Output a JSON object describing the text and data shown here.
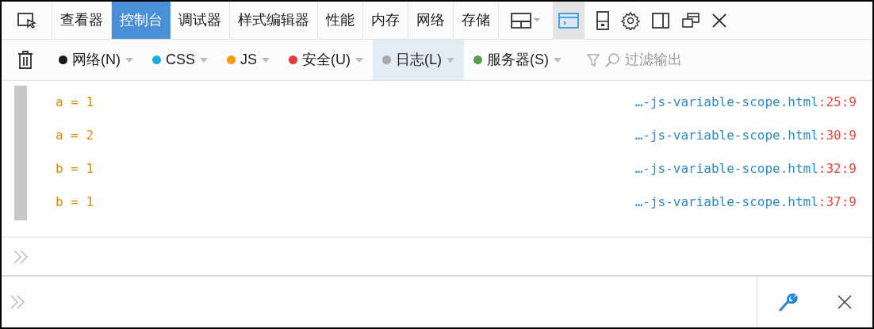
{
  "tabs": [
    {
      "label": "查看器",
      "selected": false
    },
    {
      "label": "控制台",
      "selected": true
    },
    {
      "label": "调试器",
      "selected": false
    },
    {
      "label": "样式编辑器",
      "selected": false
    },
    {
      "label": "性能",
      "selected": false
    },
    {
      "label": "内存",
      "selected": false
    },
    {
      "label": "网络",
      "selected": false
    },
    {
      "label": "存储",
      "selected": false
    }
  ],
  "filters": [
    {
      "label": "网络(N)",
      "color": "#1a1a1a",
      "selected": false
    },
    {
      "label": "CSS",
      "color": "#1fa9e1",
      "selected": false
    },
    {
      "label": "JS",
      "color": "#f39c12",
      "selected": false
    },
    {
      "label": "安全(U)",
      "color": "#e8373e",
      "selected": false
    },
    {
      "label": "日志(L)",
      "color": "#a8a8a8",
      "selected": true
    },
    {
      "label": "服务器(S)",
      "color": "#5a9e4b",
      "selected": false
    }
  ],
  "filter_field": {
    "placeholder": "过滤输出"
  },
  "messages": [
    {
      "text": "a = 1",
      "file": "…-js-variable-scope.html",
      "location": ":25:9"
    },
    {
      "text": "a = 2",
      "file": "…-js-variable-scope.html",
      "location": ":30:9"
    },
    {
      "text": "b = 1",
      "file": "…-js-variable-scope.html",
      "location": ":32:9"
    },
    {
      "text": "b = 1",
      "file": "…-js-variable-scope.html",
      "location": ":37:9"
    }
  ]
}
